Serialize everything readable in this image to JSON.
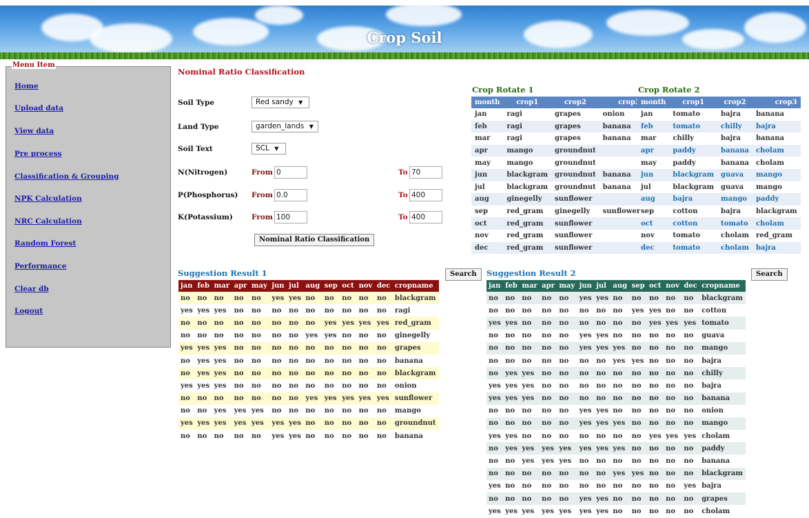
{
  "banner": {
    "title": "Crop Soil"
  },
  "sidebar": {
    "legend": "Menu Item",
    "items": [
      "Home",
      "Upload data",
      "View data",
      "Pre process",
      "Classification & Grouping",
      "NPK Calculation",
      "NRC Calculation",
      "Random Forest",
      "Performance",
      "Clear db",
      "Logout"
    ]
  },
  "form": {
    "heading": "Nominal Ratio Classification",
    "soil_type": {
      "label": "Soil Type",
      "value": "Red sandy"
    },
    "land_type": {
      "label": "Land Type",
      "value": "garden_lands"
    },
    "soil_text": {
      "label": "Soil Text",
      "value": "SCL"
    },
    "from_label": "From",
    "to_label": "To",
    "nitrogen": {
      "label": "N(Nitrogen)",
      "from": "0",
      "to": "70"
    },
    "phosphorus": {
      "label": "P(Phosphorus)",
      "from": "0.0",
      "to": "400"
    },
    "potassium": {
      "label": "K(Potassium)",
      "from": "100",
      "to": "400"
    },
    "submit_label": "Nominal Ratio Classification",
    "dropdown_glyph": "▼"
  },
  "rotate1": {
    "title": "Crop Rotate 1",
    "headers": [
      "month",
      "crop1",
      "crop2",
      "crop3"
    ],
    "rows": [
      [
        "jan",
        "ragi",
        "grapes",
        "onion"
      ],
      [
        "feb",
        "ragi",
        "grapes",
        "banana"
      ],
      [
        "mar",
        "ragi",
        "grapes",
        "banana"
      ],
      [
        "apr",
        "mango",
        "groundnut",
        ""
      ],
      [
        "may",
        "mango",
        "groundnut",
        ""
      ],
      [
        "jun",
        "blackgram",
        "groundnut",
        "banana"
      ],
      [
        "jul",
        "blackgram",
        "groundnut",
        "banana"
      ],
      [
        "aug",
        "ginegelly",
        "sunflower",
        ""
      ],
      [
        "sep",
        "red_gram",
        "ginegelly",
        "sunflower"
      ],
      [
        "oct",
        "red_gram",
        "sunflower",
        ""
      ],
      [
        "nov",
        "red_gram",
        "sunflower",
        ""
      ],
      [
        "dec",
        "red_gram",
        "sunflower",
        ""
      ]
    ]
  },
  "rotate2": {
    "title": "Crop Rotate 2",
    "headers": [
      "month",
      "crop1",
      "crop2",
      "crop3"
    ],
    "rows": [
      [
        "jan",
        "tomato",
        "bajra",
        "banana"
      ],
      [
        "feb",
        "tomato",
        "chilly",
        "bajra"
      ],
      [
        "mar",
        "chilly",
        "bajra",
        "banana"
      ],
      [
        "apr",
        "paddy",
        "banana",
        "cholam"
      ],
      [
        "may",
        "paddy",
        "banana",
        "cholam"
      ],
      [
        "jun",
        "blackgram",
        "guava",
        "mango"
      ],
      [
        "jul",
        "blackgram",
        "guava",
        "mango"
      ],
      [
        "aug",
        "bajra",
        "mango",
        "paddy"
      ],
      [
        "sep",
        "cotton",
        "bajra",
        "blackgram"
      ],
      [
        "oct",
        "cotton",
        "tomato",
        "cholam"
      ],
      [
        "nov",
        "tomato",
        "cholam",
        "red_gram"
      ],
      [
        "dec",
        "tomato",
        "cholam",
        "bajra"
      ]
    ]
  },
  "search_label": "Search",
  "suggestion1": {
    "title": "Suggestion Result 1",
    "headers": [
      "jan",
      "feb",
      "mar",
      "apr",
      "may",
      "jun",
      "jul",
      "aug",
      "sep",
      "oct",
      "nov",
      "dec",
      "cropname"
    ],
    "rows": [
      [
        "no",
        "no",
        "no",
        "no",
        "no",
        "yes",
        "yes",
        "no",
        "no",
        "no",
        "no",
        "no",
        "blackgram"
      ],
      [
        "yes",
        "yes",
        "yes",
        "no",
        "no",
        "no",
        "no",
        "no",
        "no",
        "no",
        "no",
        "no",
        "ragi"
      ],
      [
        "no",
        "no",
        "no",
        "no",
        "no",
        "no",
        "no",
        "no",
        "yes",
        "yes",
        "yes",
        "yes",
        "red_gram"
      ],
      [
        "no",
        "no",
        "no",
        "no",
        "no",
        "no",
        "no",
        "yes",
        "yes",
        "no",
        "no",
        "no",
        "ginegelly"
      ],
      [
        "yes",
        "yes",
        "yes",
        "no",
        "no",
        "no",
        "no",
        "no",
        "no",
        "no",
        "no",
        "no",
        "grapes"
      ],
      [
        "no",
        "yes",
        "yes",
        "no",
        "no",
        "no",
        "no",
        "no",
        "no",
        "no",
        "no",
        "no",
        "banana"
      ],
      [
        "no",
        "yes",
        "yes",
        "no",
        "no",
        "no",
        "no",
        "no",
        "no",
        "no",
        "no",
        "no",
        "blackgram"
      ],
      [
        "yes",
        "yes",
        "yes",
        "no",
        "no",
        "no",
        "no",
        "no",
        "no",
        "no",
        "no",
        "no",
        "onion"
      ],
      [
        "no",
        "no",
        "no",
        "no",
        "no",
        "no",
        "no",
        "yes",
        "yes",
        "yes",
        "yes",
        "yes",
        "sunflower"
      ],
      [
        "no",
        "no",
        "yes",
        "yes",
        "yes",
        "no",
        "no",
        "no",
        "no",
        "no",
        "no",
        "no",
        "mango"
      ],
      [
        "yes",
        "yes",
        "yes",
        "yes",
        "yes",
        "yes",
        "yes",
        "no",
        "no",
        "no",
        "no",
        "no",
        "groundnut"
      ],
      [
        "no",
        "no",
        "no",
        "no",
        "no",
        "yes",
        "yes",
        "no",
        "no",
        "no",
        "no",
        "no",
        "banana"
      ]
    ]
  },
  "suggestion2": {
    "title": "Suggestion Result 2",
    "headers": [
      "jan",
      "feb",
      "mar",
      "apr",
      "may",
      "jun",
      "jul",
      "aug",
      "sep",
      "oct",
      "nov",
      "dec",
      "cropname"
    ],
    "rows": [
      [
        "no",
        "no",
        "no",
        "no",
        "no",
        "yes",
        "yes",
        "no",
        "no",
        "no",
        "no",
        "no",
        "blackgram"
      ],
      [
        "no",
        "no",
        "no",
        "no",
        "no",
        "no",
        "no",
        "no",
        "yes",
        "yes",
        "no",
        "no",
        "cotton"
      ],
      [
        "yes",
        "yes",
        "no",
        "no",
        "no",
        "no",
        "no",
        "no",
        "no",
        "yes",
        "yes",
        "yes",
        "tomato"
      ],
      [
        "no",
        "no",
        "no",
        "no",
        "no",
        "yes",
        "yes",
        "no",
        "no",
        "no",
        "no",
        "no",
        "guava"
      ],
      [
        "no",
        "no",
        "no",
        "no",
        "no",
        "yes",
        "yes",
        "yes",
        "no",
        "no",
        "no",
        "no",
        "mango"
      ],
      [
        "no",
        "no",
        "no",
        "no",
        "no",
        "no",
        "no",
        "yes",
        "yes",
        "no",
        "no",
        "no",
        "bajra"
      ],
      [
        "no",
        "yes",
        "yes",
        "no",
        "no",
        "no",
        "no",
        "no",
        "no",
        "no",
        "no",
        "no",
        "chilly"
      ],
      [
        "yes",
        "yes",
        "yes",
        "no",
        "no",
        "no",
        "no",
        "no",
        "no",
        "no",
        "no",
        "no",
        "bajra"
      ],
      [
        "yes",
        "yes",
        "yes",
        "no",
        "no",
        "no",
        "no",
        "no",
        "no",
        "no",
        "no",
        "no",
        "banana"
      ],
      [
        "no",
        "no",
        "no",
        "no",
        "no",
        "yes",
        "yes",
        "no",
        "no",
        "no",
        "no",
        "no",
        "onion"
      ],
      [
        "no",
        "no",
        "no",
        "no",
        "no",
        "yes",
        "yes",
        "yes",
        "no",
        "no",
        "no",
        "no",
        "mango"
      ],
      [
        "yes",
        "yes",
        "no",
        "no",
        "no",
        "no",
        "no",
        "no",
        "no",
        "yes",
        "yes",
        "yes",
        "cholam"
      ],
      [
        "no",
        "yes",
        "yes",
        "yes",
        "yes",
        "yes",
        "yes",
        "yes",
        "no",
        "no",
        "no",
        "no",
        "paddy"
      ],
      [
        "no",
        "no",
        "yes",
        "yes",
        "yes",
        "no",
        "no",
        "no",
        "no",
        "no",
        "no",
        "no",
        "banana"
      ],
      [
        "no",
        "no",
        "no",
        "no",
        "no",
        "no",
        "no",
        "yes",
        "yes",
        "no",
        "no",
        "no",
        "blackgram"
      ],
      [
        "yes",
        "no",
        "no",
        "no",
        "no",
        "no",
        "no",
        "no",
        "no",
        "no",
        "no",
        "yes",
        "bajra"
      ],
      [
        "no",
        "no",
        "no",
        "no",
        "no",
        "yes",
        "yes",
        "no",
        "no",
        "no",
        "no",
        "no",
        "grapes"
      ],
      [
        "yes",
        "yes",
        "yes",
        "yes",
        "yes",
        "yes",
        "yes",
        "no",
        "no",
        "no",
        "no",
        "no",
        "cholam"
      ]
    ]
  },
  "colors": {
    "menu_link": "#1a1aa8",
    "heading_red": "#b0141e",
    "rotate_header": "#5b86c4",
    "suggestion1_header": "#8b1010",
    "suggestion2_header": "#276a5a",
    "suggestion1_alt_row": "#fffbd0",
    "suggestion2_alt_row": "#e6eded"
  }
}
